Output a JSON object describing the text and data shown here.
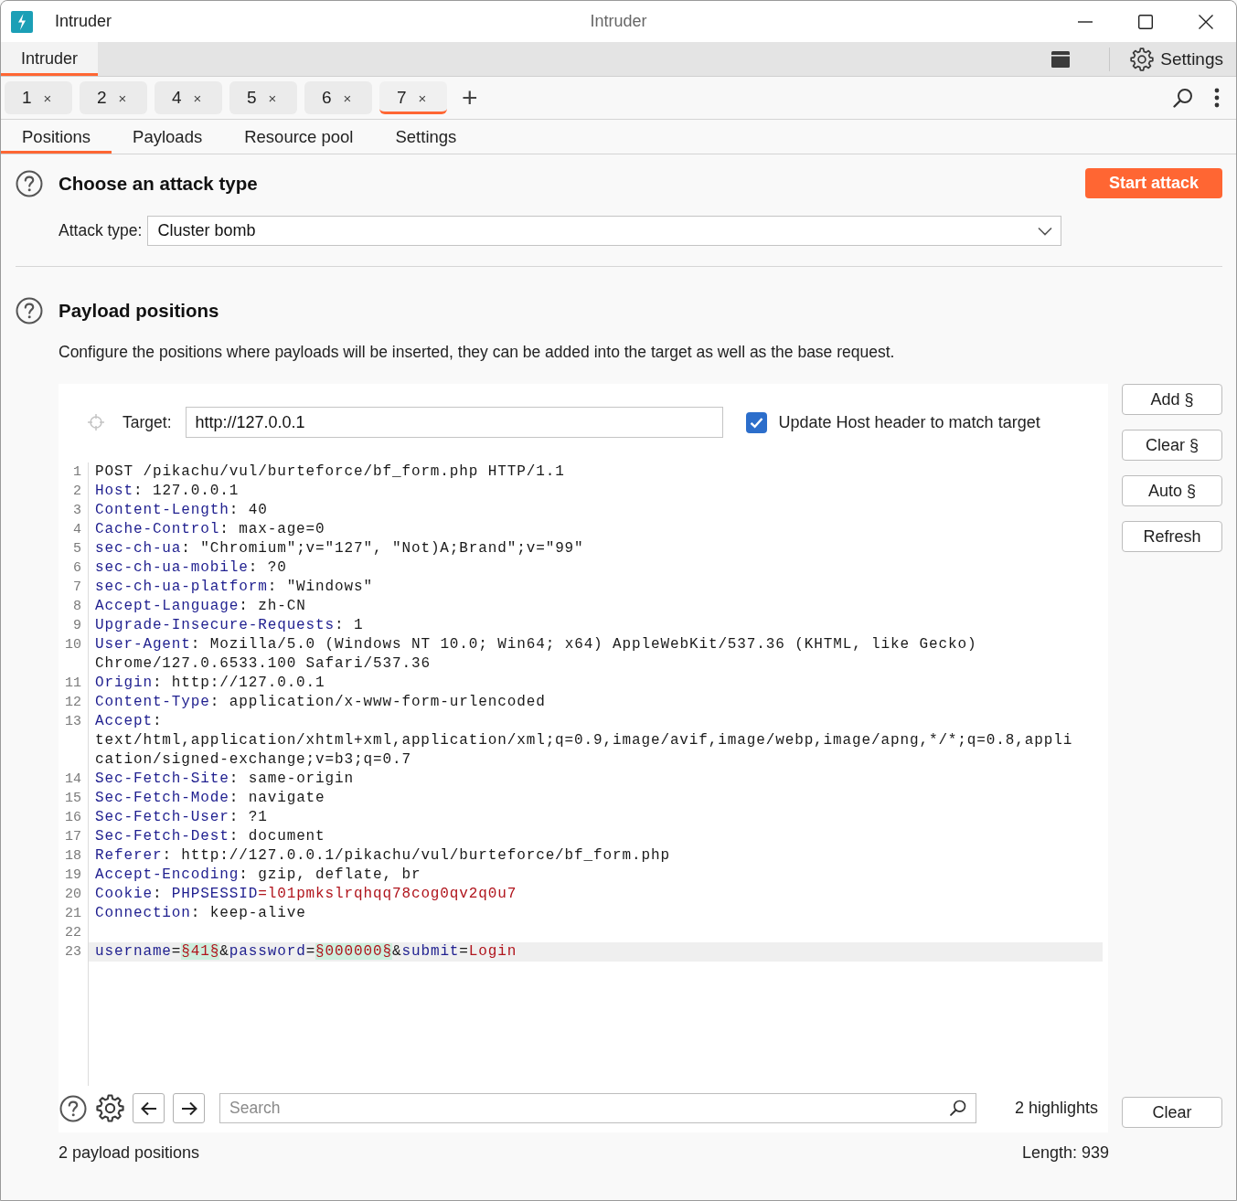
{
  "window": {
    "title": "Intruder",
    "caption": "Intruder"
  },
  "main_tabs": [
    {
      "label": "Intruder",
      "selected": true
    }
  ],
  "toolbar": {
    "settings": "Settings"
  },
  "request_tabs": [
    {
      "label": "1",
      "close": "×",
      "selected": false
    },
    {
      "label": "2",
      "close": "×",
      "selected": false
    },
    {
      "label": "4",
      "close": "×",
      "selected": false
    },
    {
      "label": "5",
      "close": "×",
      "selected": false
    },
    {
      "label": "6",
      "close": "×",
      "selected": false
    },
    {
      "label": "7",
      "close": "×",
      "selected": true
    }
  ],
  "new_tab": "+",
  "sub_tabs": [
    {
      "label": "Positions",
      "selected": true
    },
    {
      "label": "Payloads",
      "selected": false
    },
    {
      "label": "Resource pool",
      "selected": false
    },
    {
      "label": "Settings",
      "selected": false
    }
  ],
  "attack_section": {
    "title": "Choose an attack type",
    "start_button": "Start attack",
    "attack_type_label": "Attack type:",
    "attack_type": "Cluster bomb"
  },
  "positions_section": {
    "title": "Payload positions",
    "description": "Configure the positions where payloads will be inserted, they can be added into the target as well as the base request."
  },
  "target": {
    "label": "Target:",
    "value": "http://127.0.0.1",
    "update_host": {
      "label": "Update Host header to match target",
      "checked": true
    }
  },
  "side_buttons": [
    "Add §",
    "Clear §",
    "Auto §",
    "Refresh"
  ],
  "request_lines": [
    {
      "number": "1",
      "current": false,
      "segments": [
        {
          "kind": "plain",
          "text": "POST /pikachu/vul/burteforce/bf_form.php HTTP/1.1"
        }
      ]
    },
    {
      "number": "2",
      "current": false,
      "segments": [
        {
          "kind": "key",
          "text": "Host"
        },
        {
          "kind": "plain",
          "text": ": 127.0.0.1"
        }
      ]
    },
    {
      "number": "3",
      "current": false,
      "segments": [
        {
          "kind": "key",
          "text": "Content-Length"
        },
        {
          "kind": "plain",
          "text": ": 40"
        }
      ]
    },
    {
      "number": "4",
      "current": false,
      "segments": [
        {
          "kind": "key",
          "text": "Cache-Control"
        },
        {
          "kind": "plain",
          "text": ": max-age=0"
        }
      ]
    },
    {
      "number": "5",
      "current": false,
      "segments": [
        {
          "kind": "key",
          "text": "sec-ch-ua"
        },
        {
          "kind": "plain",
          "text": ": \"Chromium\";v=\"127\", \"Not)A;Brand\";v=\"99\""
        }
      ]
    },
    {
      "number": "6",
      "current": false,
      "segments": [
        {
          "kind": "key",
          "text": "sec-ch-ua-mobile"
        },
        {
          "kind": "plain",
          "text": ": ?0"
        }
      ]
    },
    {
      "number": "7",
      "current": false,
      "segments": [
        {
          "kind": "key",
          "text": "sec-ch-ua-platform"
        },
        {
          "kind": "plain",
          "text": ": \"Windows\""
        }
      ]
    },
    {
      "number": "8",
      "current": false,
      "segments": [
        {
          "kind": "key",
          "text": "Accept-Language"
        },
        {
          "kind": "plain",
          "text": ": zh-CN"
        }
      ]
    },
    {
      "number": "9",
      "current": false,
      "segments": [
        {
          "kind": "key",
          "text": "Upgrade-Insecure-Requests"
        },
        {
          "kind": "plain",
          "text": ": 1"
        }
      ]
    },
    {
      "number": "10",
      "current": false,
      "segments": [
        {
          "kind": "key",
          "text": "User-Agent"
        },
        {
          "kind": "plain",
          "text": ": Mozilla/5.0 (Windows NT 10.0; Win64; x64) AppleWebKit/537.36 (KHTML, like Gecko) Chrome/127.0.6533.100 Safari/537.36"
        }
      ]
    },
    {
      "number": "11",
      "current": false,
      "segments": [
        {
          "kind": "key",
          "text": "Origin"
        },
        {
          "kind": "plain",
          "text": ": http://127.0.0.1"
        }
      ]
    },
    {
      "number": "12",
      "current": false,
      "segments": [
        {
          "kind": "key",
          "text": "Content-Type"
        },
        {
          "kind": "plain",
          "text": ": application/x-www-form-urlencoded"
        }
      ]
    },
    {
      "number": "13",
      "current": false,
      "segments": [
        {
          "kind": "key",
          "text": "Accept"
        },
        {
          "kind": "plain",
          "text": ": text/html,application/xhtml+xml,application/xml;q=0.9,image/avif,image/webp,image/apng,*/*;q=0.8,application/signed-exchange;v=b3;q=0.7"
        }
      ]
    },
    {
      "number": "14",
      "current": false,
      "segments": [
        {
          "kind": "key",
          "text": "Sec-Fetch-Site"
        },
        {
          "kind": "plain",
          "text": ": same-origin"
        }
      ]
    },
    {
      "number": "15",
      "current": false,
      "segments": [
        {
          "kind": "key",
          "text": "Sec-Fetch-Mode"
        },
        {
          "kind": "plain",
          "text": ": navigate"
        }
      ]
    },
    {
      "number": "16",
      "current": false,
      "segments": [
        {
          "kind": "key",
          "text": "Sec-Fetch-User"
        },
        {
          "kind": "plain",
          "text": ": ?1"
        }
      ]
    },
    {
      "number": "17",
      "current": false,
      "segments": [
        {
          "kind": "key",
          "text": "Sec-Fetch-Dest"
        },
        {
          "kind": "plain",
          "text": ": document"
        }
      ]
    },
    {
      "number": "18",
      "current": false,
      "segments": [
        {
          "kind": "key",
          "text": "Referer"
        },
        {
          "kind": "plain",
          "text": ": http://127.0.0.1/pikachu/vul/burteforce/bf_form.php"
        }
      ]
    },
    {
      "number": "19",
      "current": false,
      "segments": [
        {
          "kind": "key",
          "text": "Accept-Encoding"
        },
        {
          "kind": "plain",
          "text": ": gzip, deflate, br"
        }
      ]
    },
    {
      "number": "20",
      "current": false,
      "segments": [
        {
          "kind": "key",
          "text": "Cookie"
        },
        {
          "kind": "plain",
          "text": ": "
        },
        {
          "kind": "key",
          "text": "PHPSESSID"
        },
        {
          "kind": "literal",
          "text": "=l01pmkslrqhqq78cog0qv2q0u7"
        }
      ]
    },
    {
      "number": "21",
      "current": false,
      "segments": [
        {
          "kind": "key",
          "text": "Connection"
        },
        {
          "kind": "plain",
          "text": ": keep-alive"
        }
      ]
    },
    {
      "number": "22",
      "current": false
    },
    {
      "number": "23",
      "current": true,
      "segments": [
        {
          "kind": "key",
          "text": "username"
        },
        {
          "kind": "plain",
          "text": "="
        },
        {
          "kind": "marker",
          "text": "§41§"
        },
        {
          "kind": "plain",
          "text": "&"
        },
        {
          "kind": "key",
          "text": "password"
        },
        {
          "kind": "plain",
          "text": "="
        },
        {
          "kind": "marker",
          "text": "§000000§"
        },
        {
          "kind": "plain",
          "text": "&"
        },
        {
          "kind": "key",
          "text": "submit"
        },
        {
          "kind": "plain",
          "text": "="
        },
        {
          "kind": "literal",
          "text": "Login"
        }
      ]
    }
  ],
  "search": {
    "placeholder": "Search",
    "highlights": "2 highlights",
    "clear_button": "Clear"
  },
  "status": {
    "positions": "2 payload positions",
    "length": "Length: 939"
  }
}
